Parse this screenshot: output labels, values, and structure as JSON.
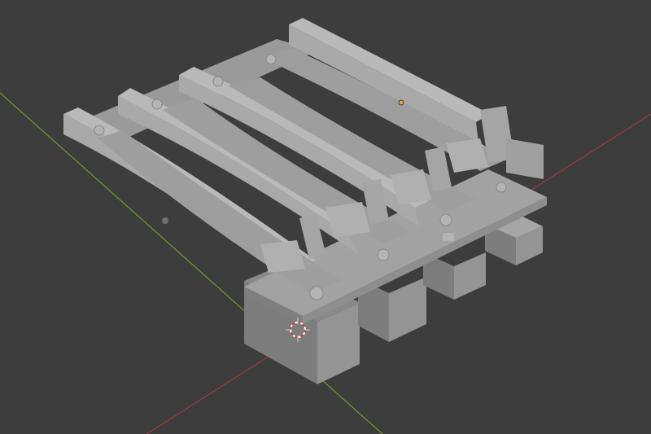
{
  "app": "3D viewport",
  "viewport": {
    "background": "#3d3d3d",
    "x_axis_color": "#a33a42",
    "y_axis_color": "#6b9a2a",
    "origin_color": "#e7a23b",
    "cursor_colors": [
      "#d33b3b",
      "#ffffff"
    ]
  },
  "model": {
    "name": "track-piece",
    "material_color": "#9c9c9c",
    "rail_count": 4,
    "block_count": 4
  },
  "icons": {
    "cursor": "3d-cursor-icon",
    "origin": "object-origin-icon"
  }
}
